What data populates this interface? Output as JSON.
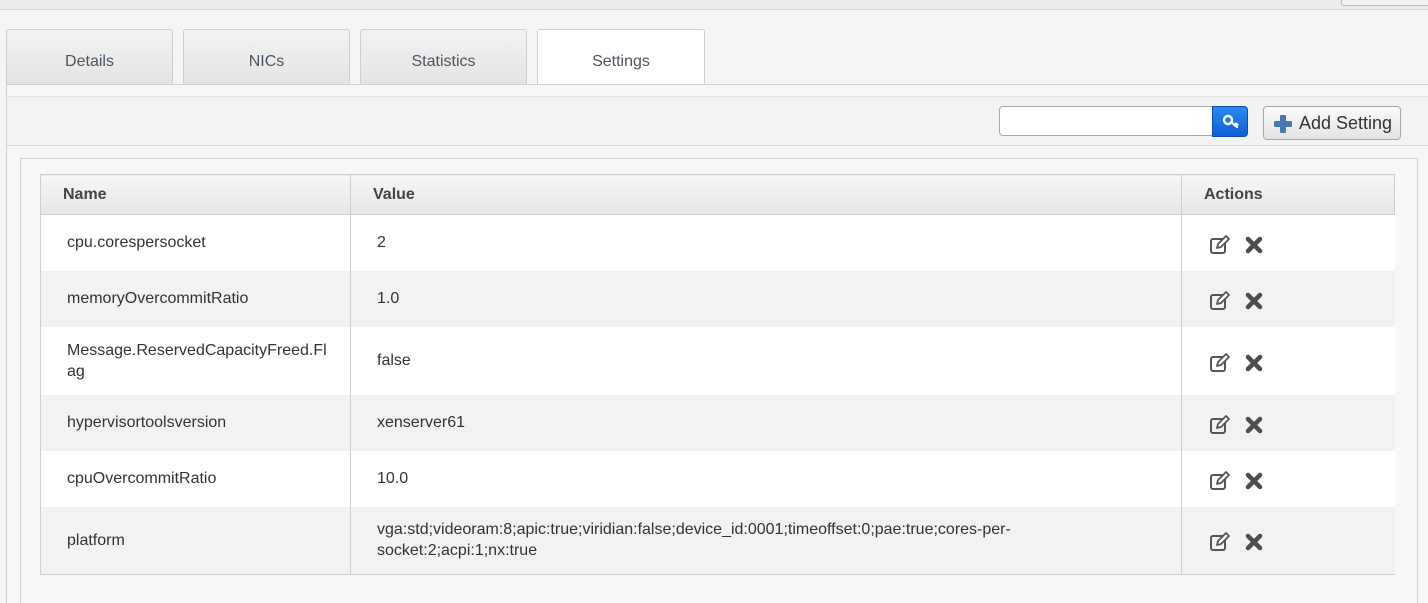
{
  "tabs": [
    {
      "label": "Details",
      "active": false
    },
    {
      "label": "NICs",
      "active": false
    },
    {
      "label": "Statistics",
      "active": false
    },
    {
      "label": "Settings",
      "active": true
    }
  ],
  "toolbar": {
    "search_value": "",
    "search_icon": "search-icon",
    "add_setting_label": "Add Setting",
    "add_icon": "plus-icon"
  },
  "table": {
    "columns": [
      "Name",
      "Value",
      "Actions"
    ],
    "rows": [
      {
        "name": "cpu.corespersocket",
        "value": "2"
      },
      {
        "name": "memoryOvercommitRatio",
        "value": "1.0"
      },
      {
        "name": "Message.ReservedCapacityFreed.Flag",
        "value": "false"
      },
      {
        "name": "hypervisortoolsversion",
        "value": "xenserver61"
      },
      {
        "name": "cpuOvercommitRatio",
        "value": "10.0"
      },
      {
        "name": "platform",
        "value": "vga:std;videoram:8;apic:true;viridian:false;device_id:0001;timeoffset:0;pae:true;cores-per-socket:2;acpi:1;nx:true"
      }
    ],
    "row_actions": [
      "edit-icon",
      "delete-icon"
    ]
  },
  "colors": {
    "search_button": "#1a73e8",
    "plus_icon": "#4a77b4",
    "action_icon": "#555555"
  }
}
